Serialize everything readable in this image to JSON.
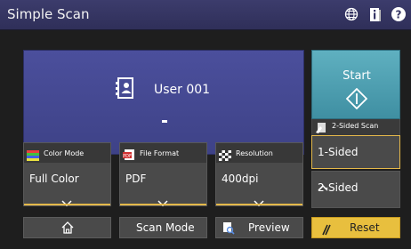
{
  "app": {
    "title": "Simple Scan"
  },
  "titlebar": {
    "icons": [
      "globe-icon",
      "info-icon",
      "help-icon"
    ]
  },
  "user": {
    "name": "User 001",
    "icon": "user-card-icon"
  },
  "start": {
    "label": "Start",
    "icon": "start-diamond-icon",
    "color": "#4fa2b4"
  },
  "sided": {
    "header": "2-Sided Scan",
    "options": [
      "1-Sided",
      "2-Sided"
    ],
    "selected": "1-Sided"
  },
  "settings": [
    {
      "label": "Color Mode",
      "value": "Full Color",
      "icon": "color-mode-icon"
    },
    {
      "label": "File Format",
      "value": "PDF",
      "icon": "pdf-icon"
    },
    {
      "label": "Resolution",
      "value": "400dpi",
      "icon": "resolution-icon"
    }
  ],
  "bottom": {
    "home_icon": "home-icon",
    "scan_mode": "Scan Mode",
    "preview": "Preview",
    "reset": "Reset"
  },
  "colors": {
    "accent": "#e5b94a",
    "panel": "#4a4a4a",
    "user_panel": "#454a95",
    "titlebar": "#353565"
  }
}
